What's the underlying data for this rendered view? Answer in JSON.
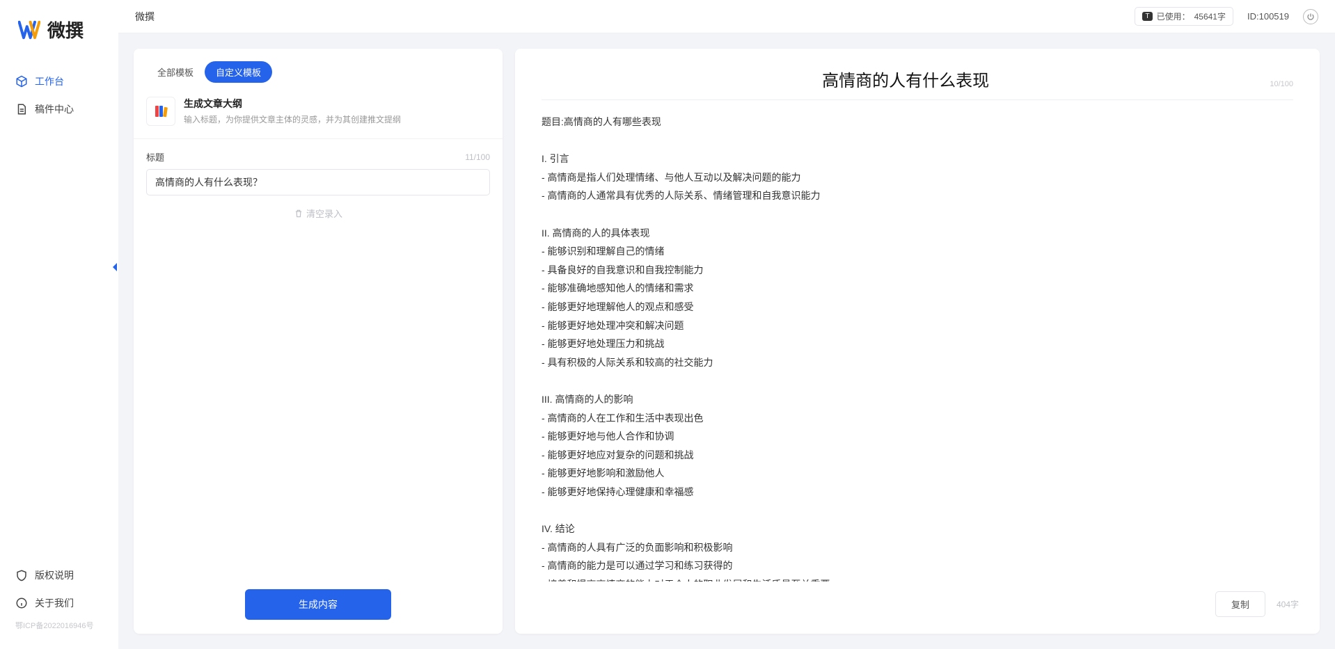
{
  "app_name": "微撰",
  "sidebar": {
    "items": [
      {
        "label": "工作台",
        "active": true
      },
      {
        "label": "稿件中心",
        "active": false
      }
    ],
    "bottom": [
      {
        "label": "版权说明"
      },
      {
        "label": "关于我们"
      }
    ],
    "icp": "鄂ICP备2022016946号"
  },
  "topbar": {
    "breadcrumb": "微撰",
    "usage_prefix": "已使用：",
    "usage_value": "45641字",
    "id_label": "ID:",
    "id_value": "100519"
  },
  "left_panel": {
    "tabs": [
      {
        "label": "全部模板",
        "active": false
      },
      {
        "label": "自定义模板",
        "active": true
      }
    ],
    "template": {
      "title": "生成文章大纲",
      "desc": "输入标题，为你提供文章主体的灵感，并为其创建推文提纲"
    },
    "field": {
      "label": "标题",
      "counter": "11/100",
      "value": "高情商的人有什么表现？"
    },
    "clear_label": "清空录入",
    "generate_label": "生成内容"
  },
  "right_panel": {
    "title": "高情商的人有什么表现",
    "title_counter": "10/100",
    "body": "题目:高情商的人有哪些表现\n\nI. 引言\n- 高情商是指人们处理情绪、与他人互动以及解决问题的能力\n- 高情商的人通常具有优秀的人际关系、情绪管理和自我意识能力\n\nII. 高情商的人的具体表现\n- 能够识别和理解自己的情绪\n- 具备良好的自我意识和自我控制能力\n- 能够准确地感知他人的情绪和需求\n- 能够更好地理解他人的观点和感受\n- 能够更好地处理冲突和解决问题\n- 能够更好地处理压力和挑战\n- 具有积极的人际关系和较高的社交能力\n\nIII. 高情商的人的影响\n- 高情商的人在工作和生活中表现出色\n- 能够更好地与他人合作和协调\n- 能够更好地应对复杂的问题和挑战\n- 能够更好地影响和激励他人\n- 能够更好地保持心理健康和幸福感\n\nIV. 结论\n- 高情商的人具有广泛的负面影响和积极影响\n- 高情商的能力是可以通过学习和练习获得的\n- 培养和提高高情商的能力对于个人的职业发展和生活质量至关重要。",
    "copy_label": "复制",
    "word_count": "404字"
  }
}
